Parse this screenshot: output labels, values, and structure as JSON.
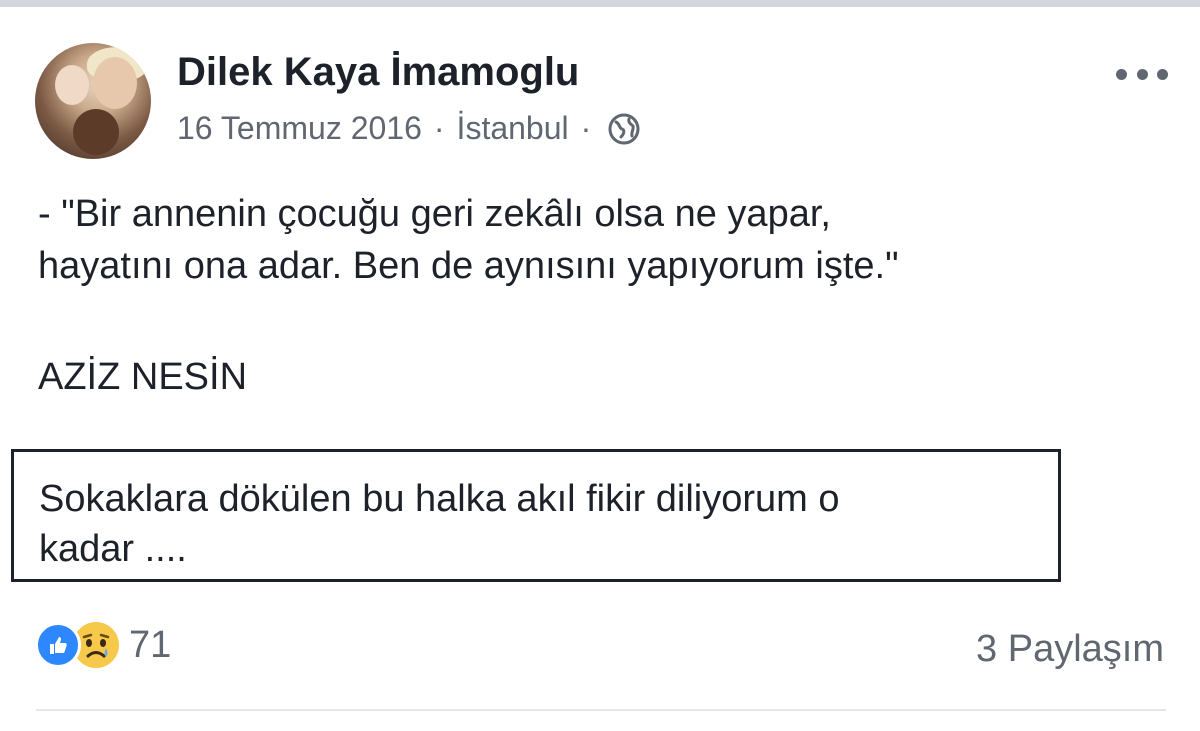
{
  "post": {
    "author": "Dilek Kaya İmamoglu",
    "date": "16 Temmuz 2016",
    "separator": "·",
    "location": "İstanbul",
    "privacy_icon": "globe-icon",
    "text_line1": "- \"Bir annenin çocuğu geri zekâlı olsa ne yapar,",
    "text_line2": "hayatını ona adar. Ben de aynısını yapıyorum işte.\"",
    "quote_author": "AZİZ NESİN",
    "boxed_line1": "Sokaklara dökülen bu halka akıl fikir diliyorum o",
    "boxed_line2": "kadar ...."
  },
  "footer": {
    "reaction_icons": [
      "like-icon",
      "sad-icon"
    ],
    "reaction_count": "71",
    "shares": "3 Paylaşım"
  },
  "colors": {
    "text": "#1d2129",
    "secondary_text": "#606770",
    "like_blue": "#2d88ff",
    "sad_yellow": "#f7c94a"
  }
}
